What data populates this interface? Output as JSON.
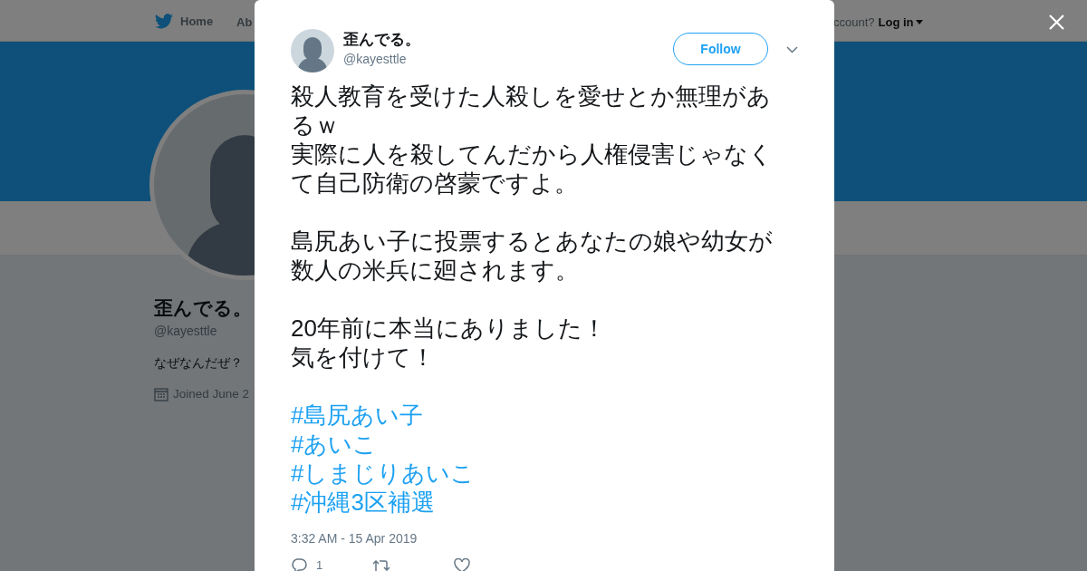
{
  "background": {
    "nav": {
      "home": "Home",
      "about": "Ab",
      "account_prompt": "ccount?",
      "login": "Log in"
    },
    "profile": {
      "name": "歪んでる。",
      "handle": "@kayesttle",
      "bio": "なぜなんだぜ？",
      "joined": "Joined June 2"
    }
  },
  "tweet": {
    "name": "歪んでる。",
    "handle": "@kayesttle",
    "follow": "Follow",
    "paragraphs": [
      [
        "殺人教育を受けた人殺しを愛せとか無理があるｗ",
        "実際に人を殺してんだから人権侵害じゃなくて自己防衛の啓蒙ですよ。"
      ],
      [
        "島尻あい子に投票するとあなたの娘や幼女が数人の米兵に廻されます。"
      ],
      [
        "20年前に本当にありました！",
        "気を付けて！"
      ]
    ],
    "hashtags": [
      "#島尻あい子",
      "#あいこ",
      "#しまじりあいこ",
      "#沖縄3区補選"
    ],
    "time": "3:32 AM - 15 Apr 2019",
    "actions": [
      {
        "kind": "reply",
        "count": "1"
      },
      {
        "kind": "retweet"
      },
      {
        "kind": "like"
      }
    ]
  }
}
